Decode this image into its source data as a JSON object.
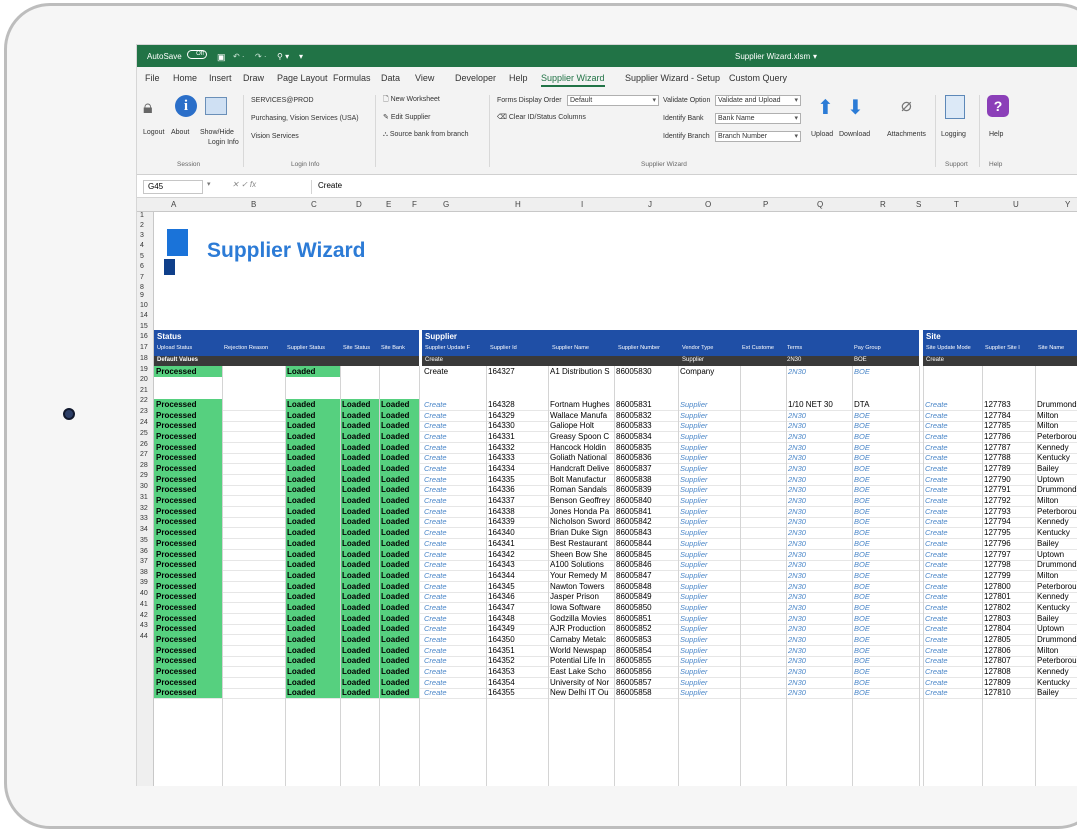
{
  "window": {
    "title": "Supplier Wizard.xlsm",
    "autosave": "AutoSave",
    "toggle": "Off"
  },
  "menu": [
    "File",
    "Home",
    "Insert",
    "Draw",
    "Page Layout",
    "Formulas",
    "Data",
    "View",
    "Developer",
    "Help",
    "Supplier Wizard",
    "Supplier Wizard - Setup",
    "Custom Query"
  ],
  "ribbon": {
    "session": {
      "logout": "Logout",
      "about": "About",
      "showhide": "Show/Hide",
      "logininfo_btn": "Login Info",
      "group": "Session"
    },
    "login_info": {
      "line1": "SERVICES@PROD",
      "line2": "Purchasing, Vision Services (USA)",
      "line3": "Vision Services",
      "group": "Login Info"
    },
    "actions": {
      "new_ws": "New Worksheet",
      "edit_supplier": "Edit Supplier",
      "source_bank": "Source bank from branch"
    },
    "forms": {
      "order_label": "Forms Display Order",
      "order_value": "Default",
      "clear": "Clear ID/Status Columns"
    },
    "validate": {
      "label": "Validate Option",
      "value": "Validate and Upload",
      "bank_label": "Identify Bank",
      "bank_value": "Bank Name",
      "branch_label": "Identify Branch",
      "branch_value": "Branch Number"
    },
    "upload": "Upload",
    "download": "Download",
    "attachments": "Attachments",
    "wizard_group": "Supplier Wizard",
    "logging": "Logging",
    "support_group": "Support",
    "help": "Help",
    "help_group": "Help"
  },
  "formula": {
    "namebox": "G45",
    "fx": "fx",
    "value": "Create"
  },
  "columns": [
    "A",
    "B",
    "C",
    "D",
    "E",
    "F",
    "G",
    "H",
    "I",
    "J",
    "O",
    "P",
    "Q",
    "R",
    "S",
    "T",
    "U",
    "Y"
  ],
  "brand": "Supplier Wizard",
  "sections": {
    "status": {
      "title": "Status",
      "cols": [
        "Upload Status",
        "Rejection Reason",
        "Supplier Status",
        "Site Status",
        "Site Bank"
      ]
    },
    "supplier": {
      "title": "Supplier",
      "cols": [
        "Supplier Update F",
        "Supplier Id",
        "Supplier Name",
        "Supplier Number",
        "Vendor Type",
        "Ext Custome",
        "Terms",
        "Pay Group"
      ]
    },
    "site": {
      "title": "Site",
      "cols": [
        "Site Update Mode",
        "Supplier Site I",
        "Site Name"
      ]
    }
  },
  "defaults_row": {
    "label": "Default Values",
    "create": "Create",
    "vendor": "Supplier",
    "terms": "2N30",
    "pay": "BOE",
    "site_create": "Create"
  },
  "row14": {
    "status": "Processed",
    "supplier_status": "Loaded",
    "mode": "Create",
    "id": "164327",
    "name": "A1 Distribution S",
    "number": "86005830",
    "vendor": "Company",
    "terms": "2N30",
    "pay": "BOE"
  },
  "row_numbers": [
    "1",
    "2",
    "3",
    "4",
    "5",
    "6",
    "7",
    "8",
    "9",
    "10",
    "14",
    "15",
    "16",
    "17",
    "18",
    "19",
    "20",
    "21",
    "22",
    "23",
    "24",
    "25",
    "26",
    "27",
    "28",
    "29",
    "30",
    "31",
    "32",
    "33",
    "34",
    "35",
    "36",
    "37",
    "38",
    "39",
    "40",
    "41",
    "42",
    "43",
    "44"
  ],
  "rows": [
    {
      "n": "17",
      "id": "164328",
      "name": "Fortnam Hughes",
      "num": "86005831",
      "terms": "1/10 NET 30",
      "pay": "DTA",
      "site": "127783",
      "sname": "Drummond"
    },
    {
      "n": "18",
      "id": "164329",
      "name": "Wallace Manufa",
      "num": "86005832",
      "terms": "2N30",
      "pay": "BOE",
      "site": "127784",
      "sname": "Milton"
    },
    {
      "n": "19",
      "id": "164330",
      "name": "Galiope Holt",
      "num": "86005833",
      "terms": "2N30",
      "pay": "BOE",
      "site": "127785",
      "sname": "Milton"
    },
    {
      "n": "20",
      "id": "164331",
      "name": "Greasy Spoon C",
      "num": "86005834",
      "terms": "2N30",
      "pay": "BOE",
      "site": "127786",
      "sname": "Peterborough"
    },
    {
      "n": "21",
      "id": "164332",
      "name": "Hancock Holdin",
      "num": "86005835",
      "terms": "2N30",
      "pay": "BOE",
      "site": "127787",
      "sname": "Kennedy"
    },
    {
      "n": "22",
      "id": "164333",
      "name": "Goliath National",
      "num": "86005836",
      "terms": "2N30",
      "pay": "BOE",
      "site": "127788",
      "sname": "Kentucky"
    },
    {
      "n": "23",
      "id": "164334",
      "name": "Handcraft Delive",
      "num": "86005837",
      "terms": "2N30",
      "pay": "BOE",
      "site": "127789",
      "sname": "Bailey"
    },
    {
      "n": "24",
      "id": "164335",
      "name": "Bolt Manufactur",
      "num": "86005838",
      "terms": "2N30",
      "pay": "BOE",
      "site": "127790",
      "sname": "Uptown"
    },
    {
      "n": "25",
      "id": "164336",
      "name": "Roman Sandals",
      "num": "86005839",
      "terms": "2N30",
      "pay": "BOE",
      "site": "127791",
      "sname": "Drummond"
    },
    {
      "n": "26",
      "id": "164337",
      "name": "Benson Geoffrey",
      "num": "86005840",
      "terms": "2N30",
      "pay": "BOE",
      "site": "127792",
      "sname": "Milton"
    },
    {
      "n": "27",
      "id": "164338",
      "name": "Jones Honda Pa",
      "num": "86005841",
      "terms": "2N30",
      "pay": "BOE",
      "site": "127793",
      "sname": "Peterborough"
    },
    {
      "n": "28",
      "id": "164339",
      "name": "Nicholson Sword",
      "num": "86005842",
      "terms": "2N30",
      "pay": "BOE",
      "site": "127794",
      "sname": "Kennedy"
    },
    {
      "n": "29",
      "id": "164340",
      "name": "Brian Duke Sign",
      "num": "86005843",
      "terms": "2N30",
      "pay": "BOE",
      "site": "127795",
      "sname": "Kentucky"
    },
    {
      "n": "30",
      "id": "164341",
      "name": "Best Restaurant",
      "num": "86005844",
      "terms": "2N30",
      "pay": "BOE",
      "site": "127796",
      "sname": "Bailey"
    },
    {
      "n": "31",
      "id": "164342",
      "name": "Sheen Bow She",
      "num": "86005845",
      "terms": "2N30",
      "pay": "BOE",
      "site": "127797",
      "sname": "Uptown"
    },
    {
      "n": "32",
      "id": "164343",
      "name": "A100 Solutions",
      "num": "86005846",
      "terms": "2N30",
      "pay": "BOE",
      "site": "127798",
      "sname": "Drummond"
    },
    {
      "n": "33",
      "id": "164344",
      "name": "Your Remedy M",
      "num": "86005847",
      "terms": "2N30",
      "pay": "BOE",
      "site": "127799",
      "sname": "Milton"
    },
    {
      "n": "34",
      "id": "164345",
      "name": "Nawton Towers",
      "num": "86005848",
      "terms": "2N30",
      "pay": "BOE",
      "site": "127800",
      "sname": "Peterborough"
    },
    {
      "n": "35",
      "id": "164346",
      "name": "Jasper Prison",
      "num": "86005849",
      "terms": "2N30",
      "pay": "BOE",
      "site": "127801",
      "sname": "Kennedy"
    },
    {
      "n": "36",
      "id": "164347",
      "name": "Iowa Software",
      "num": "86005850",
      "terms": "2N30",
      "pay": "BOE",
      "site": "127802",
      "sname": "Kentucky"
    },
    {
      "n": "37",
      "id": "164348",
      "name": "Godzilla Movies",
      "num": "86005851",
      "terms": "2N30",
      "pay": "BOE",
      "site": "127803",
      "sname": "Bailey"
    },
    {
      "n": "38",
      "id": "164349",
      "name": "AJR Production",
      "num": "86005852",
      "terms": "2N30",
      "pay": "BOE",
      "site": "127804",
      "sname": "Uptown"
    },
    {
      "n": "39",
      "id": "164350",
      "name": "Carnaby Metalc",
      "num": "86005853",
      "terms": "2N30",
      "pay": "BOE",
      "site": "127805",
      "sname": "Drummond"
    },
    {
      "n": "40",
      "id": "164351",
      "name": "World Newspap",
      "num": "86005854",
      "terms": "2N30",
      "pay": "BOE",
      "site": "127806",
      "sname": "Milton"
    },
    {
      "n": "41",
      "id": "164352",
      "name": "Potential Life In",
      "num": "86005855",
      "terms": "2N30",
      "pay": "BOE",
      "site": "127807",
      "sname": "Peterborough"
    },
    {
      "n": "42",
      "id": "164353",
      "name": "East Lake Scho",
      "num": "86005856",
      "terms": "2N30",
      "pay": "BOE",
      "site": "127808",
      "sname": "Kennedy"
    },
    {
      "n": "43",
      "id": "164354",
      "name": "University of Nor",
      "num": "86005857",
      "terms": "2N30",
      "pay": "BOE",
      "site": "127809",
      "sname": "Kentucky"
    },
    {
      "n": "44",
      "id": "164355",
      "name": "New Delhi IT Ou",
      "num": "86005858",
      "terms": "2N30",
      "pay": "BOE",
      "site": "127810",
      "sname": "Bailey"
    }
  ],
  "labels": {
    "processed": "Processed",
    "loaded": "Loaded",
    "create": "Create",
    "supplier": "Supplier"
  },
  "colors": {
    "excel_green": "#217346",
    "section_blue": "#1f4fa6",
    "status_green": "#56d07f",
    "brand_blue": "#2c7bd6"
  }
}
